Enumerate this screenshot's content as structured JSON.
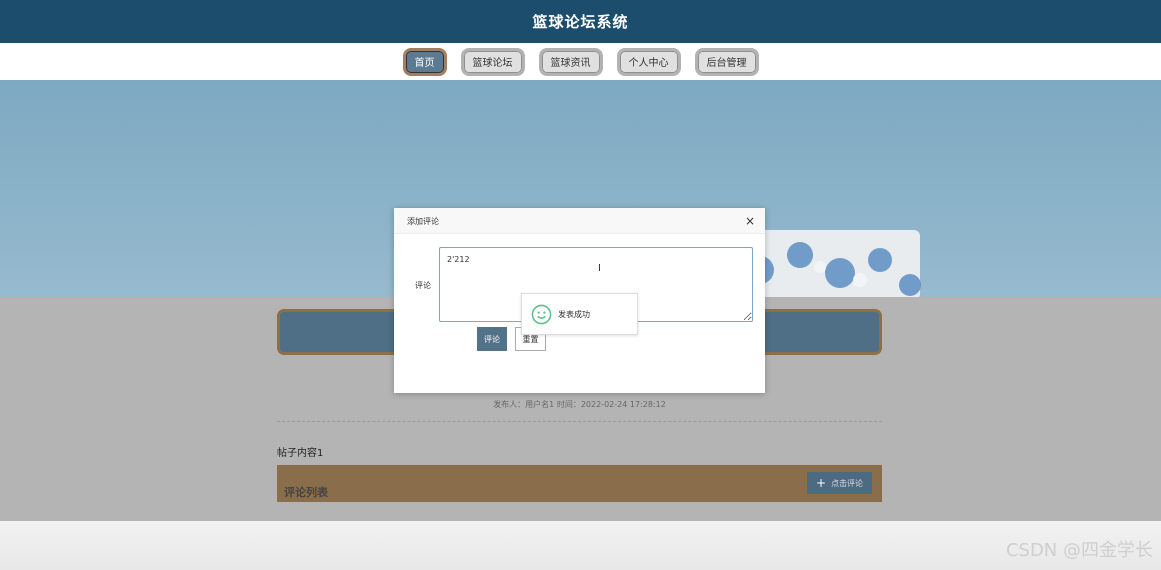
{
  "header": {
    "title": "篮球论坛系统"
  },
  "nav": {
    "items": [
      {
        "label": "首页"
      },
      {
        "label": "篮球论坛"
      },
      {
        "label": "篮球资讯"
      },
      {
        "label": "个人中心"
      },
      {
        "label": "后台管理"
      }
    ]
  },
  "post": {
    "meta": "发布人：用户名1 时间：2022-02-24 17:28:12",
    "content": "帖子内容1"
  },
  "comments": {
    "heading": "评论列表",
    "add_button": "点击评论"
  },
  "modal": {
    "title": "添加评论",
    "close": "×",
    "field_label": "评论",
    "textarea_value": "2'212",
    "submit_label": "评论",
    "reset_label": "重置"
  },
  "toast": {
    "message": "发表成功"
  },
  "watermark": "CSDN @四金学长",
  "colors": {
    "header_bg": "#1c4d6c",
    "accent": "#52728a",
    "comment_bar": "#8a6d4b"
  }
}
